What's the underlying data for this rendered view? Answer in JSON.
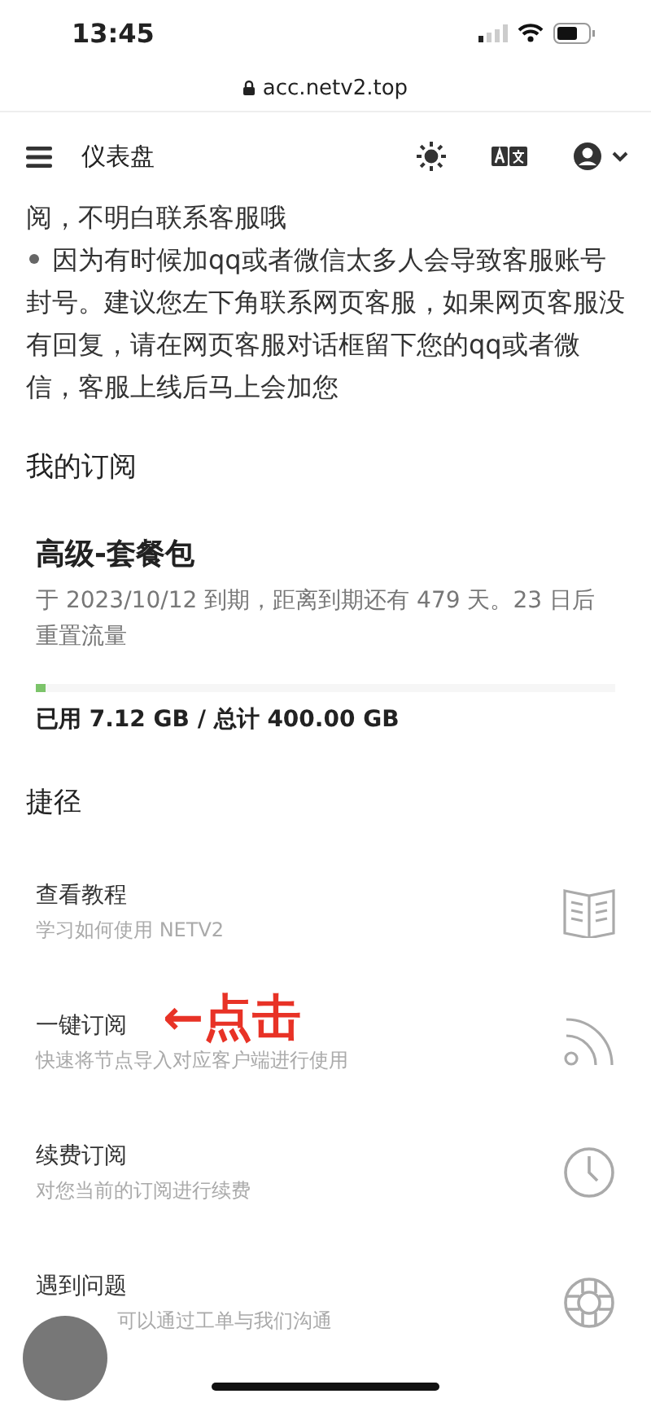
{
  "status_bar": {
    "time": "13:45"
  },
  "browser": {
    "url": "acc.netv2.top"
  },
  "header": {
    "title": "仪表盘"
  },
  "notice": [
    {
      "bullet": false,
      "text": "阅，不明白联系客服哦"
    },
    {
      "bullet": true,
      "text": "因为有时候加qq或者微信太多人会导致客服账号封号。建议您左下角联系网页客服，如果网页客服没有回复，请在网页客服对话框留下您的qq或者微信，客服上线后马上会加您"
    }
  ],
  "subscription": {
    "heading": "我的订阅",
    "plan": "高级-套餐包",
    "detail": "于 2023/10/12 到期，距离到期还有 479 天。23 日后重置流量",
    "level": 0.018,
    "usage": "已用 7.12 GB / 总计 400.00 GB"
  },
  "shortcuts": {
    "heading": "捷径",
    "items": [
      {
        "title": "查看教程",
        "subtitle": "学习如何使用 NETV2",
        "kind": "book"
      },
      {
        "title": "一键订阅",
        "subtitle": "快速将节点导入对应客户端进行使用",
        "kind": "rss",
        "annotation": "←点击"
      },
      {
        "title": "续费订阅",
        "subtitle": "对您当前的订阅进行续费",
        "kind": "clock"
      },
      {
        "title": "遇到问题",
        "subtitle": "可以通过工单与我们沟通",
        "kind": "lifebuoy"
      }
    ]
  }
}
